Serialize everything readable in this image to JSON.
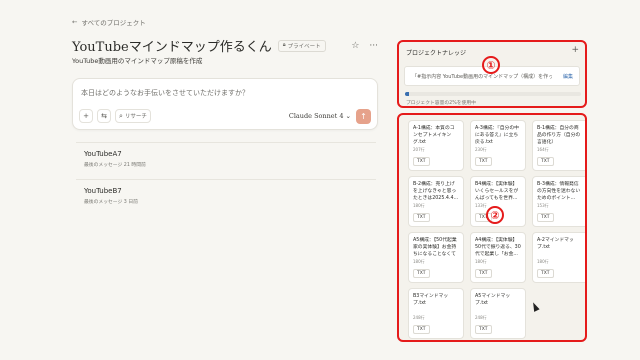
{
  "nav": {
    "back_label": "すべてのプロジェクト",
    "back_icon": "arrow-left-icon"
  },
  "project": {
    "title": "YouTubeマインドマップ作るくん",
    "privacy_badge": "プライベート",
    "star_icon": "☆",
    "more_icon": "···",
    "description": "YouTube動画用のマインドマップ原稿を作成"
  },
  "composer": {
    "placeholder": "本日はどのようなお手伝いをさせていただけますか？",
    "add_icon": "+",
    "settings_icon": "⇆",
    "research_label": "リサーチ",
    "research_icon": "⌕",
    "model_label": "Claude Sonnet 4",
    "model_chevron": "⌄",
    "send_icon": "↑"
  },
  "chats": [
    {
      "name": "YouTubeA7",
      "meta": "最後のメッセージ 21 時間前"
    },
    {
      "name": "YouTubeB7",
      "meta": "最後のメッセージ 3 日前"
    }
  ],
  "knowledge": {
    "heading": "プロジェクトナレッジ",
    "add_icon": "+",
    "instruction_text": "「#指示内容 YouTube動画用のマインドマップ（構成）を作って...",
    "edit_label": "編集",
    "usage_text": "プロジェクト容量の2%を使用中",
    "usage_fraction": 0.02,
    "accent_color": "#3a6fb0"
  },
  "annotations": {
    "one": "①",
    "two": "②",
    "color": "#e51b1b"
  },
  "files": [
    {
      "name": "A-1構成：本質のコンセプトメイキング.txt",
      "lines": "207行",
      "type": "TXT"
    },
    {
      "name": "A-3構成：『自分の中にある答え』に立ち戻る.txt",
      "lines": "230行",
      "type": "TXT"
    },
    {
      "name": "B-1構成：自分の商品の作り方（自分の言語化）2025.4.2.txt",
      "lines": "164行",
      "type": "TXT"
    },
    {
      "name": "B-2構成：売り上げを上げなきゃと思ったときは2025.4.4...",
      "lines": "180行",
      "type": "TXT"
    },
    {
      "name": "B4構成：【実体験】いくらセールスをがんばってもを世界...",
      "lines": "133行",
      "type": "TXT"
    },
    {
      "name": "B-3構成：情報発信の方向性を迷わないためのポイント...",
      "lines": "153行",
      "type": "TXT"
    },
    {
      "name": "A5構成：【50代起業家の実体験】お金持ちになることなくても...",
      "lines": "180行",
      "type": "TXT"
    },
    {
      "name": "A4構成：【実体験】50代で振り返る、30代で起業し「お金...",
      "lines": "180行",
      "type": "TXT"
    },
    {
      "name": "A-2マインドマップ.txt",
      "lines": "180行",
      "type": "TXT"
    },
    {
      "name": "B3マインドマップ.txt",
      "lines": "248行",
      "type": "TXT"
    },
    {
      "name": "A5マインドマップ.txt",
      "lines": "248行",
      "type": "TXT"
    }
  ]
}
